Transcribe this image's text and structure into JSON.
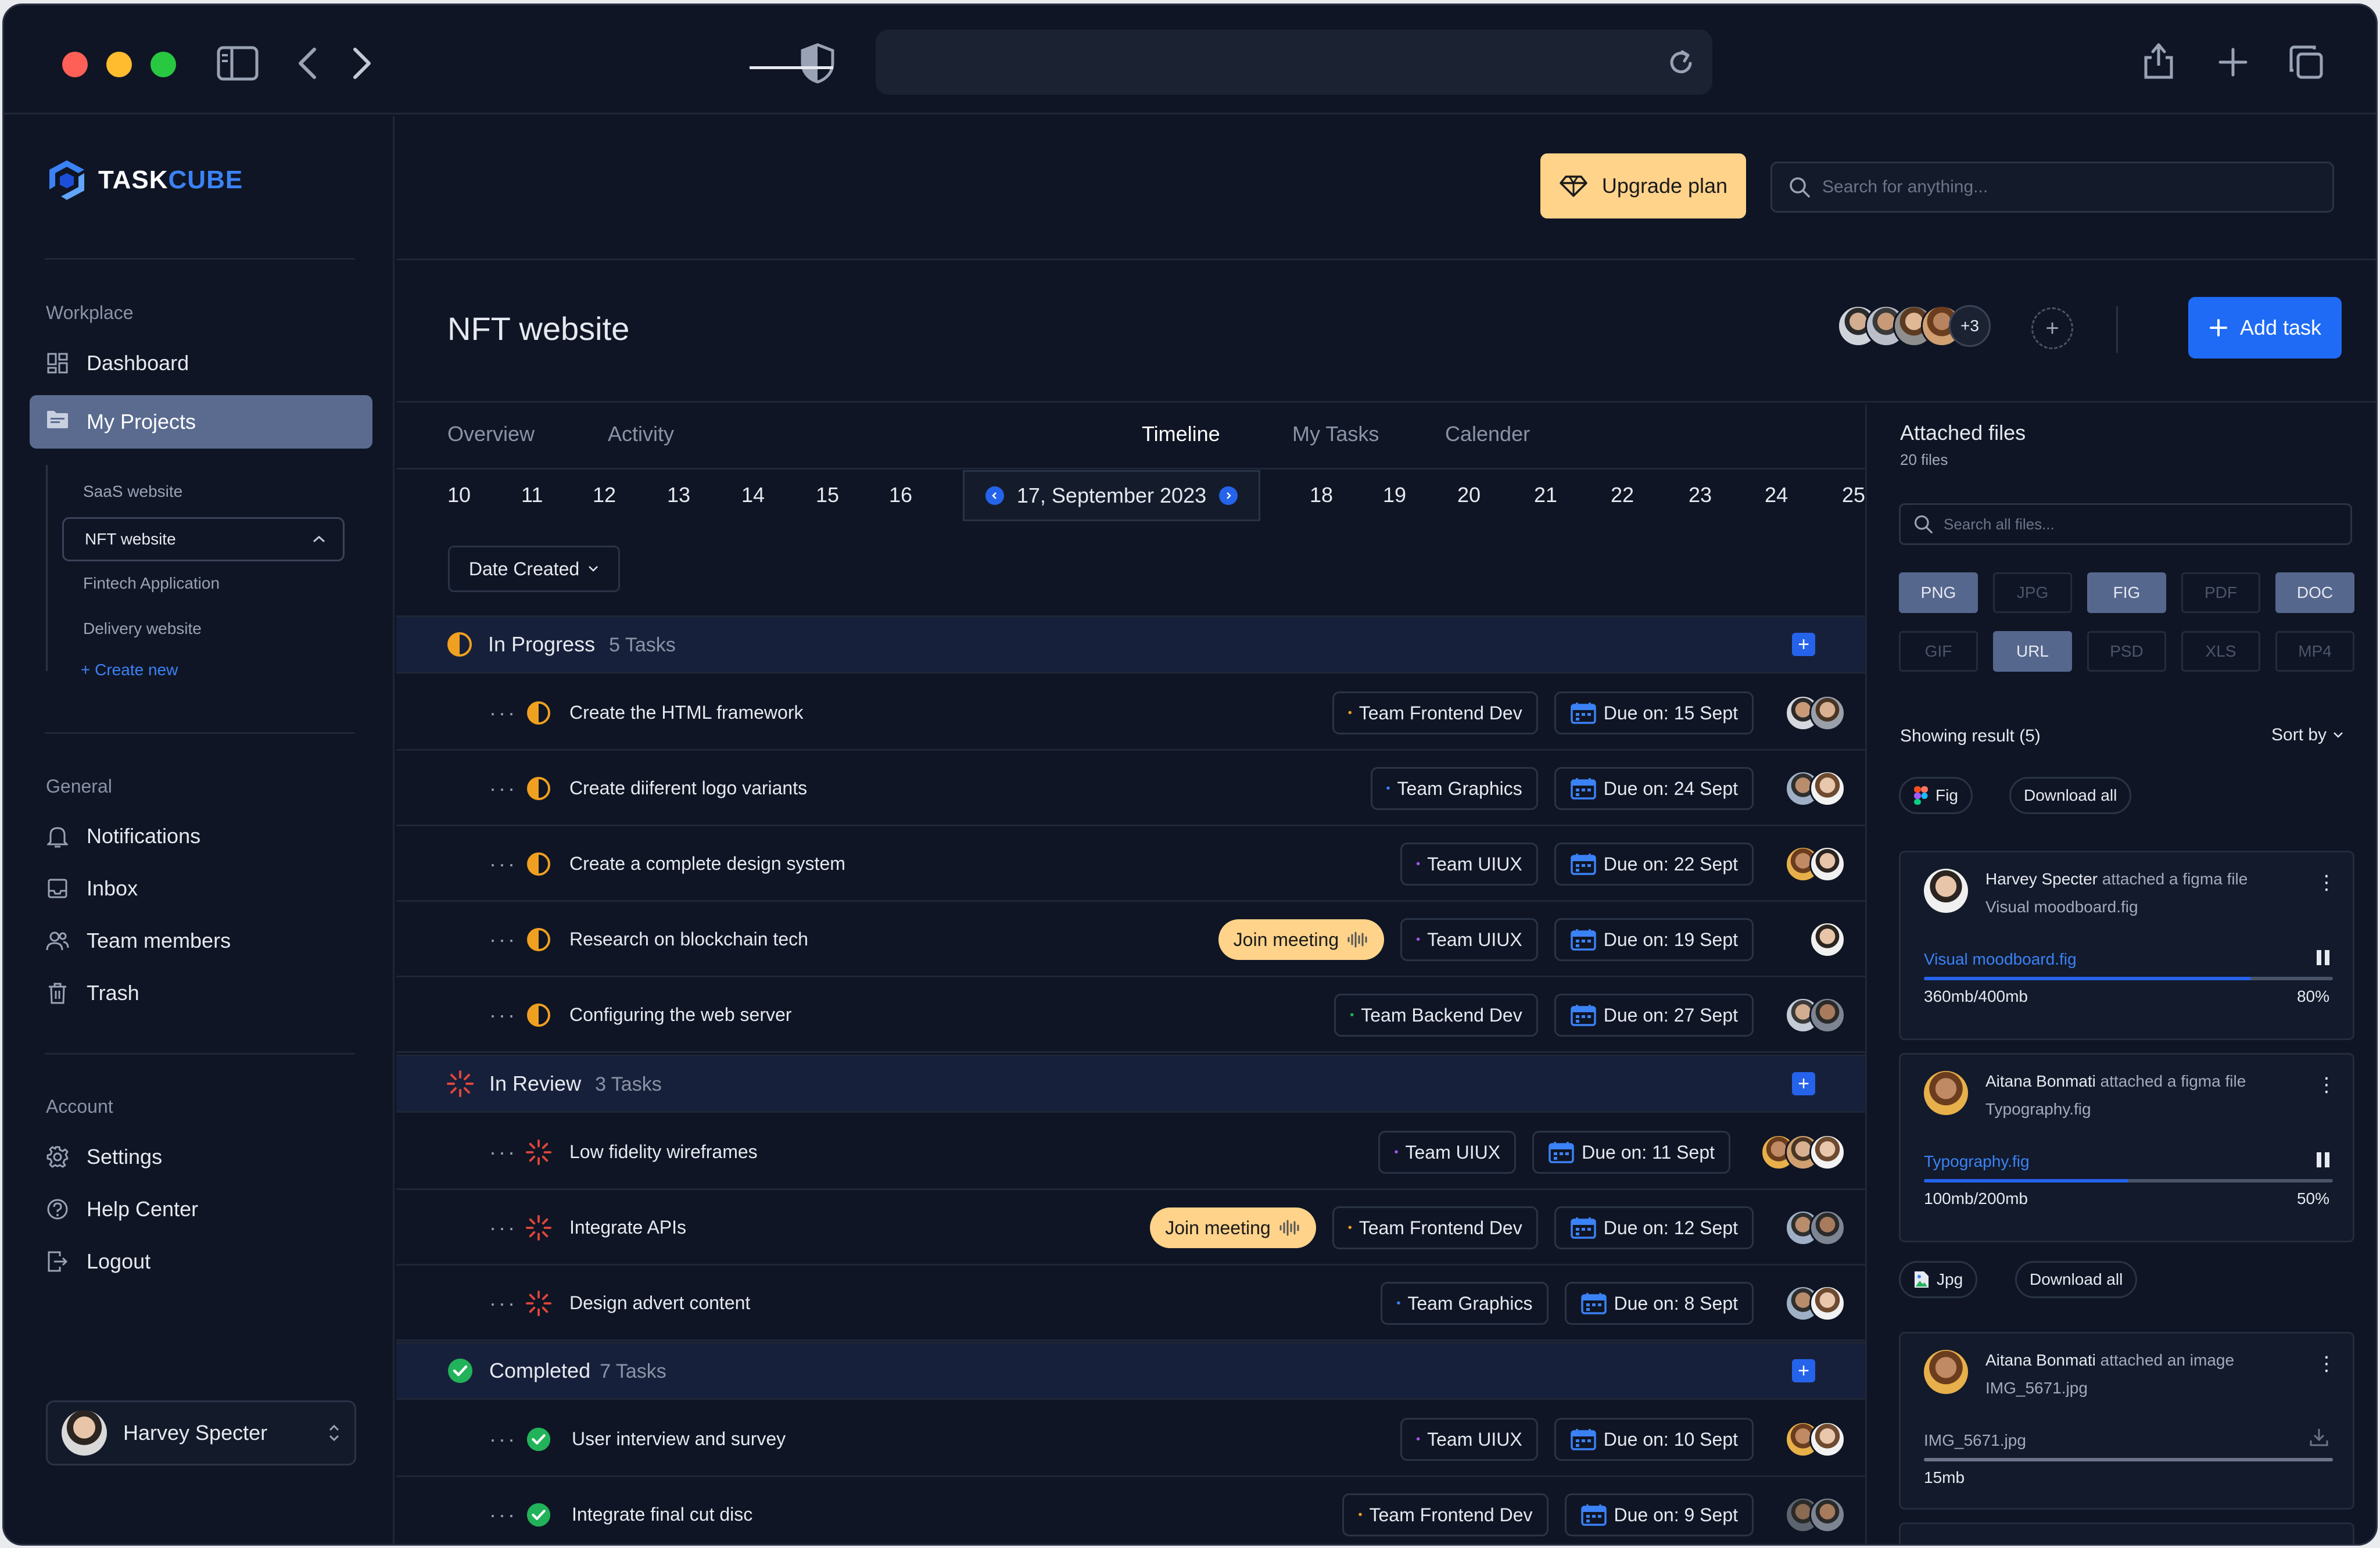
{
  "app": {
    "logo_task": "TASK",
    "logo_cube": "CUBE",
    "upgrade_label": "Upgrade plan",
    "search_placeholder": "Search for anything..."
  },
  "sidebar": {
    "workplace_label": "Workplace",
    "dashboard": "Dashboard",
    "my_projects": "My Projects",
    "projects": [
      "SaaS website",
      "NFT website",
      "Fintech Application",
      "Delivery website"
    ],
    "create_new": "Create new",
    "general_label": "General",
    "general_items": [
      "Notifications",
      "Inbox",
      "Team members",
      "Trash"
    ],
    "account_label": "Account",
    "account_items": [
      "Settings",
      "Help Center",
      "Logout"
    ],
    "user_name": "Harvey Specter"
  },
  "project": {
    "title": "NFT website",
    "extra_members": "+3",
    "add_task": "Add task"
  },
  "tabs": [
    "Overview",
    "Activity",
    "Timeline",
    "My Tasks",
    "Calender"
  ],
  "timeline": {
    "days_before": [
      "10",
      "11",
      "12",
      "13",
      "14",
      "15",
      "16"
    ],
    "selected_date": "17, September 2023",
    "days_after": [
      "18",
      "19",
      "20",
      "21",
      "22",
      "23",
      "24",
      "25"
    ],
    "filter": "Date Created"
  },
  "groups": [
    {
      "title": "In Progress",
      "count": "5 Tasks",
      "tasks": [
        {
          "name": "Create the HTML framework",
          "team": "Team Frontend Dev",
          "due": "Due on: 15 Sept",
          "join": ""
        },
        {
          "name": "Create diiferent logo variants",
          "team": "Team Graphics",
          "due": "Due on: 24 Sept",
          "join": ""
        },
        {
          "name": "Create a complete design system",
          "team": "Team UIUX",
          "due": "Due on: 22 Sept",
          "join": ""
        },
        {
          "name": "Research on blockchain tech",
          "team": "Team UIUX",
          "due": "Due on: 19 Sept",
          "join": "Join meeting"
        },
        {
          "name": "Configuring the web server",
          "team": "Team Backend Dev",
          "due": "Due on: 27 Sept",
          "join": ""
        }
      ]
    },
    {
      "title": "In Review",
      "count": "3 Tasks",
      "tasks": [
        {
          "name": "Low fidelity wireframes",
          "team": "Team UIUX",
          "due": "Due on: 11 Sept",
          "join": ""
        },
        {
          "name": "Integrate APIs",
          "team": "Team Frontend Dev",
          "due": "Due on: 12 Sept",
          "join": "Join meeting"
        },
        {
          "name": "Design advert content",
          "team": "Team Graphics",
          "due": "Due on: 8 Sept",
          "join": ""
        }
      ]
    },
    {
      "title": "Completed",
      "count": "7 Tasks",
      "tasks": [
        {
          "name": "User interview and survey",
          "team": "Team UIUX",
          "due": "Due on: 10 Sept",
          "join": ""
        },
        {
          "name": "Integrate final cut disc",
          "team": "Team Frontend Dev",
          "due": "Due on: 9 Sept",
          "join": ""
        }
      ]
    }
  ],
  "files": {
    "title": "Attached files",
    "count": "20 files",
    "search_placeholder": "Search all files...",
    "types": [
      "PNG",
      "JPG",
      "FIG",
      "PDF",
      "DOC",
      "GIF",
      "URL",
      "PSD",
      "XLS",
      "MP4"
    ],
    "types_on": [
      "PNG",
      "FIG",
      "DOC",
      "URL"
    ],
    "showing": "Showing result (5)",
    "sort_by": "Sort by",
    "fig_tag": "Fig",
    "jpg_tag": "Jpg",
    "download_all": "Download all",
    "cards": [
      {
        "user": "Harvey Specter",
        "action": " attached a figma file",
        "file": "Visual moodboard.fig",
        "link": "Visual moodboard.fig",
        "size": "360mb/400mb",
        "pct": "80%",
        "progress": 0.8
      },
      {
        "user": "Aitana Bonmati",
        "action": " attached a figma file",
        "file": "Typography.fig",
        "link": "Typography.fig",
        "size": "100mb/200mb",
        "pct": "50%",
        "progress": 0.5
      },
      {
        "user": "Aitana Bonmati",
        "action": " attached an image",
        "file": "IMG_5671.jpg",
        "link": "IMG_5671.jpg",
        "size": "15mb",
        "pct": "",
        "progress": 1.0
      }
    ]
  },
  "colors": {
    "accent": "#1f6bf5",
    "upgrade": "#ffd38a",
    "in_progress": "#f0a020",
    "in_review": "#e0463c",
    "completed": "#22b25a"
  }
}
